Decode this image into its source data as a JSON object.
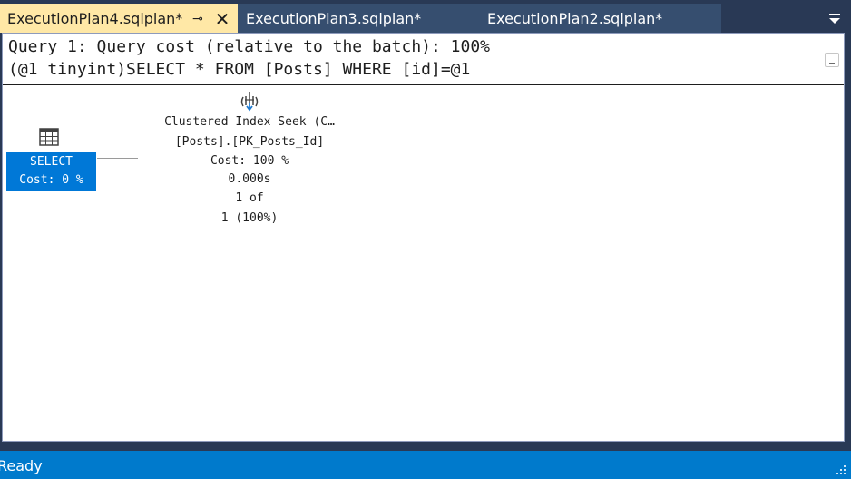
{
  "tabs": [
    {
      "label": "ExecutionPlan4.sqlplan*",
      "active": true,
      "pin_glyph": "⊸",
      "close_glyph": "✕"
    },
    {
      "label": "ExecutionPlan3.sqlplan*",
      "active": false
    },
    {
      "label": "ExecutionPlan2.sqlplan*",
      "active": false
    }
  ],
  "query": {
    "line1": "Query 1: Query cost (relative to the batch): 100%",
    "line2": "(@1 tinyint)SELECT * FROM [Posts] WHERE [id]=@1"
  },
  "plan": {
    "select_node": {
      "icon": "table-grid-icon",
      "label": "SELECT",
      "cost": "Cost: 0 %"
    },
    "seek_node": {
      "icon": "clustered-index-seek-icon",
      "name": "Clustered Index Seek (C…",
      "object": "[Posts].[PK_Posts_Id]",
      "cost": "Cost: 100 %",
      "time": "0.000s",
      "rows": "1 of",
      "rows_pct": "1 (100%)"
    }
  },
  "status": {
    "text": "Ready"
  },
  "colors": {
    "tab_active_bg": "#ffe8a6",
    "tab_inactive_bg": "#364e6f",
    "chrome_bg": "#293955",
    "status_bg": "#007acc",
    "selected_node_bg": "#0078d7"
  }
}
